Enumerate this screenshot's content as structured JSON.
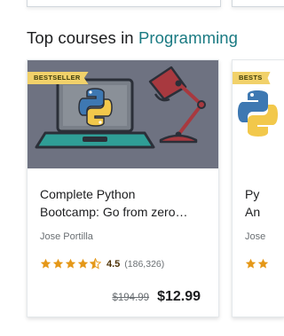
{
  "section": {
    "title_prefix": "Top courses in ",
    "title_accent": "Programming"
  },
  "courses": [
    {
      "badge": "BESTSELLER",
      "title_line1": "Complete Python",
      "title_line2": "Bootcamp: Go from zero…",
      "author": "Jose Portilla",
      "rating": "4.5",
      "rating_stars": 4.5,
      "rating_count": "(186,326)",
      "old_price": "$194.99",
      "new_price": "$12.99"
    },
    {
      "badge": "BESTS",
      "title_line1": "Py",
      "title_line2": "An",
      "author": "Jose"
    }
  ],
  "colors": {
    "accent": "#1a7a82",
    "badge_bg": "#f1d16a",
    "star": "#e59819",
    "thumb_bg": "#6e7281"
  },
  "icons": {
    "thumbnail_elements": [
      "laptop",
      "python-logo",
      "desk-lamp"
    ],
    "rating": "star-icon"
  }
}
